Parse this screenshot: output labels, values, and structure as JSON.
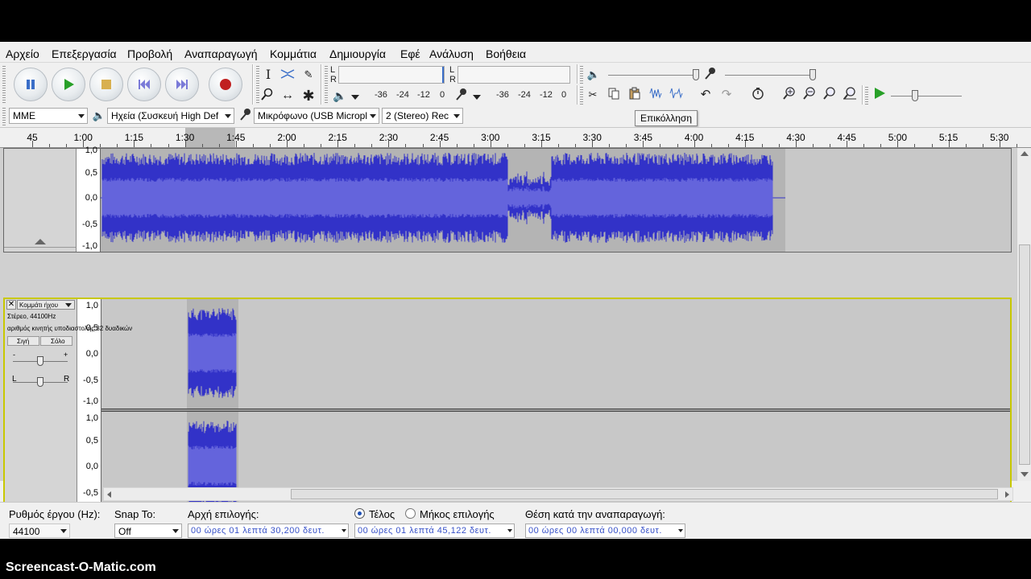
{
  "menu": [
    "Αρχείο",
    "Επεξεργασία",
    "Προβολή",
    "Αναπαραγωγή",
    "Κομμάτια",
    "Δημιουργία",
    "Εφέ",
    "Ανάλυση",
    "Βοήθεια"
  ],
  "meter": {
    "channel_left": "L",
    "channel_right": "R",
    "playback_ticks": [
      "-36",
      "-24",
      "-12",
      "0"
    ],
    "record_ticks": [
      "-36",
      "-24",
      "-12",
      "0"
    ]
  },
  "device": {
    "host": "MME",
    "output": "Ηχεία (Συσκευή High Def",
    "input": "Μικρόφωνο (USB Micropl",
    "channels": "2 (Stereo) Rec"
  },
  "tooltip": "Επικόλληση",
  "ruler": [
    "45",
    "1:00",
    "1:15",
    "1:30",
    "1:45",
    "2:00",
    "2:15",
    "2:30",
    "2:45",
    "3:00",
    "3:15",
    "3:30",
    "3:45",
    "4:00",
    "4:15",
    "4:30",
    "4:45",
    "5:00",
    "5:15",
    "5:30"
  ],
  "scale": {
    "top": "1,0",
    "upper": "0,5",
    "mid": "0,0",
    "lower": "-0,5",
    "bottom": "-1,0"
  },
  "track2": {
    "name": "Κομμάτι ήχου",
    "format": "Στέρεο, 44100Hz",
    "bits": "αριθμός κινητής υποδιαστολής 32 δυαδικών",
    "mute": "Σιγή",
    "solo": "Σόλο",
    "gain_minus": "-",
    "gain_plus": "+",
    "pan_left": "L",
    "pan_right": "R",
    "close_glyph": "✕"
  },
  "selection_bar": {
    "rate_label": "Ρυθμός έργου (Hz):",
    "rate_value": "44100",
    "snap_label": "Snap To:",
    "snap_value": "Off",
    "start_label": "Αρχή επιλογής:",
    "end_option": "Τέλος",
    "length_option": "Μήκος επιλογής",
    "position_label": "Θέση κατά την αναπαραγωγή:",
    "start_value": "00 ώρες 01 λεπτά 30,200 δευτ.",
    "end_value": "00 ώρες 01 λεπτά 45,122 δευτ.",
    "position_value": "00 ώρες 00 λεπτά 00,000 δευτ."
  },
  "watermark": "Screencast-O-Matic.com",
  "colors": {
    "wave": "#3232c8",
    "wave_rms": "#6464dc",
    "selection": "#b4b4b4",
    "track_bg": "#c8c8c8",
    "selected_border": "#c8c800",
    "play_green": "#28a028",
    "record_red": "#c02020",
    "pause_blue": "#3a6ec8"
  }
}
